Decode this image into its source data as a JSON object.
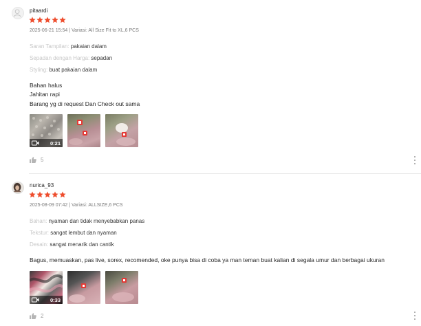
{
  "colors": {
    "star": "#ee4d2d",
    "muted_label": "#c7c7c7",
    "meta_text": "#8a8a8a",
    "like": "#b5b5b5"
  },
  "reviews": [
    {
      "author": "pitaardi",
      "rating": 5,
      "meta": "2025-06-21 15:54 | Variasi: All Size Fit to XL,6 PCS",
      "attributes": [
        {
          "label": "Saran Tampilan:",
          "value": "pakaian dalam"
        },
        {
          "label": "Sepadan dengan Harga:",
          "value": "sepadan"
        },
        {
          "label": "Styling:",
          "value": "buat pakaian dalam"
        }
      ],
      "body": [
        "Bahan halus",
        "Jahitan rapi",
        "Barang yg di request Dan Check out sama"
      ],
      "video_duration": "0:21",
      "likes": "5"
    },
    {
      "author": "nurica_93",
      "rating": 5,
      "meta": "2025-08-09 07:42 | Variasi: ALLSIZE,6 PCS",
      "attributes": [
        {
          "label": "Bahan:",
          "value": "nyaman dan tidak menyebabkan panas"
        },
        {
          "label": "Tekstur:",
          "value": "sangat lembut dan nyaman"
        },
        {
          "label": "Desain:",
          "value": "sangat menarik dan cantik"
        }
      ],
      "body": [
        "Bagus, memuaskan, pas live, sorex, recomended, oke punya bisa di coba ya man teman buat kalian di segala umur dan berbagai ukuran"
      ],
      "video_duration": "0:33",
      "likes": "2"
    }
  ]
}
